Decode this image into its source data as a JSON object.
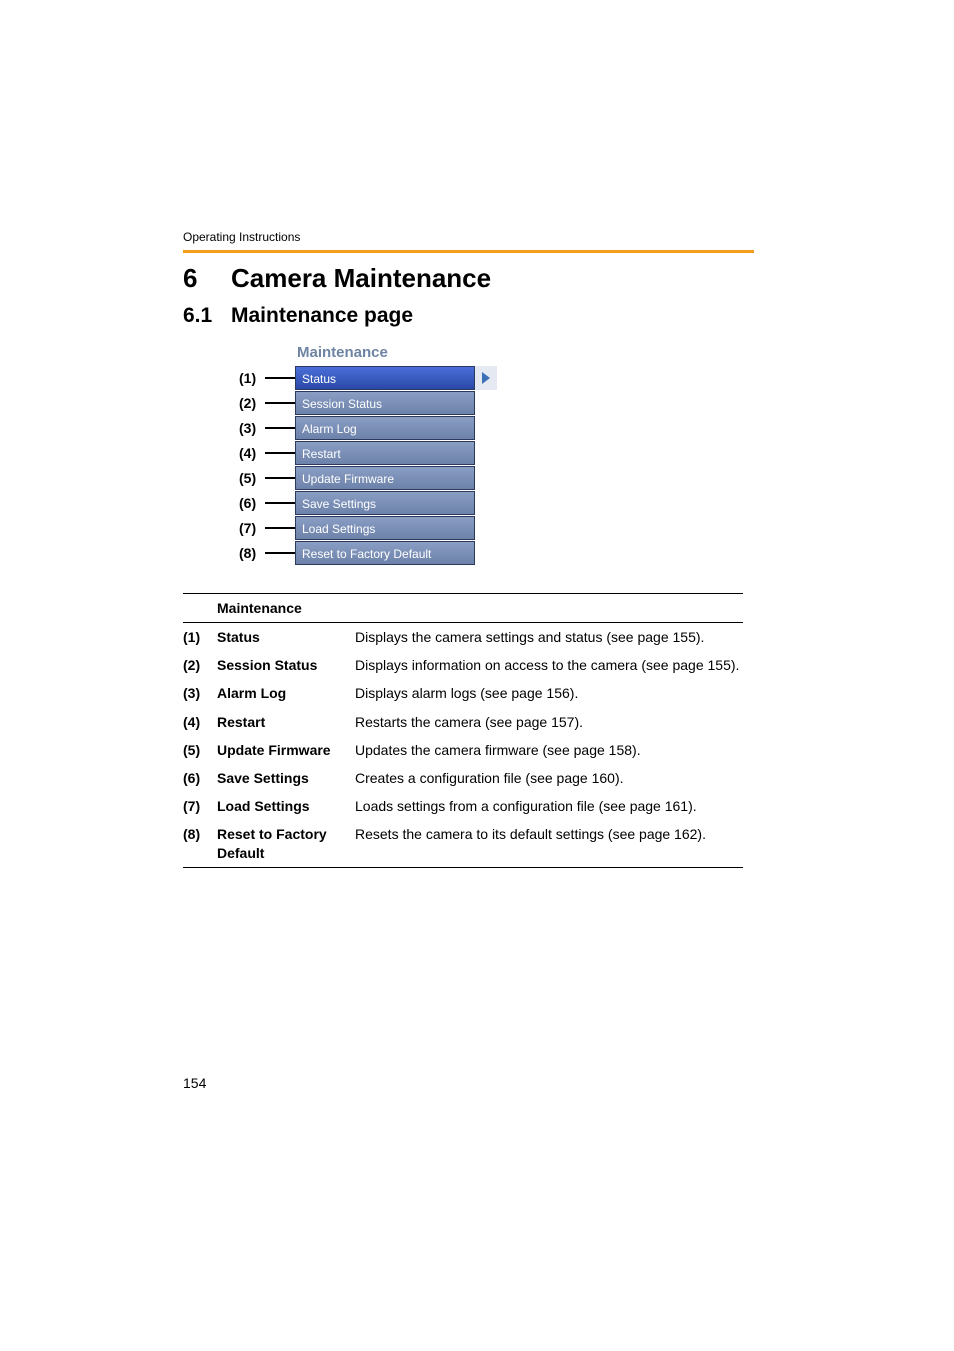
{
  "runningHeader": "Operating Instructions",
  "chapter": {
    "number": "6",
    "title": "Camera Maintenance"
  },
  "section": {
    "number": "6.1",
    "title": "Maintenance page"
  },
  "menu": {
    "header": "Maintenance",
    "items": [
      {
        "num": "(1)",
        "label": "Status",
        "selected": true
      },
      {
        "num": "(2)",
        "label": "Session Status",
        "selected": false
      },
      {
        "num": "(3)",
        "label": "Alarm Log",
        "selected": false
      },
      {
        "num": "(4)",
        "label": "Restart",
        "selected": false
      },
      {
        "num": "(5)",
        "label": "Update Firmware",
        "selected": false
      },
      {
        "num": "(6)",
        "label": "Save Settings",
        "selected": false
      },
      {
        "num": "(7)",
        "label": "Load Settings",
        "selected": false
      },
      {
        "num": "(8)",
        "label": "Reset to Factory Default",
        "selected": false
      }
    ]
  },
  "desc": {
    "header": "Maintenance",
    "rows": [
      {
        "num": "(1)",
        "name": "Status",
        "text": "Displays the camera settings and status (see page 155)."
      },
      {
        "num": "(2)",
        "name": "Session Status",
        "text": "Displays information on access to the camera (see page 155)."
      },
      {
        "num": "(3)",
        "name": "Alarm Log",
        "text": "Displays alarm logs (see page 156)."
      },
      {
        "num": "(4)",
        "name": "Restart",
        "text": "Restarts the camera (see page 157)."
      },
      {
        "num": "(5)",
        "name": "Update Firmware",
        "text": "Updates the camera firmware (see page 158)."
      },
      {
        "num": "(6)",
        "name": "Save Settings",
        "text": "Creates a configuration file (see page 160)."
      },
      {
        "num": "(7)",
        "name": "Load Settings",
        "text": "Loads settings from a configuration file (see page 161)."
      },
      {
        "num": "(8)",
        "name": "Reset to Factory Default",
        "text": "Resets the camera to its default settings (see page 162)."
      }
    ]
  },
  "pageNumber": "154"
}
